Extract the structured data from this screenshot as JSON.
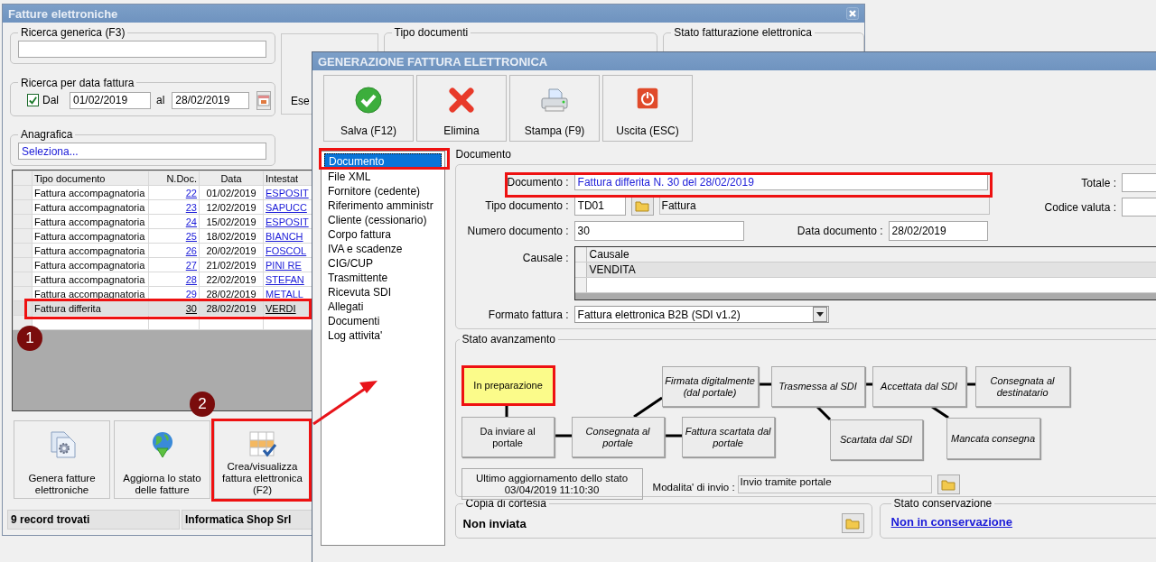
{
  "main_window": {
    "title": "Fatture elettroniche",
    "generic_search": {
      "label": "Ricerca generica (F3)"
    },
    "date_search": {
      "label": "Ricerca per data fattura",
      "from_checked": true,
      "from_label": "Dal",
      "from": "01/02/2019",
      "to_label": "al",
      "to": "28/02/2019"
    },
    "registry": {
      "label": "Anagrafica",
      "value": "Seleziona..."
    },
    "search_button": {
      "label": "Ese"
    },
    "document_types": {
      "label": "Tipo documenti"
    },
    "invoicing_status": {
      "label": "Stato fatturazione elettronica"
    },
    "table": {
      "columns": [
        "Tipo documento",
        "N.Doc.",
        "Data",
        "Intestat"
      ],
      "rows": [
        {
          "type": "Fattura accompagnatoria",
          "number": "22",
          "date": "01/02/2019",
          "holder": "ESPOSIT",
          "selected": false
        },
        {
          "type": "Fattura accompagnatoria",
          "number": "23",
          "date": "12/02/2019",
          "holder": "SAPUCC",
          "selected": false
        },
        {
          "type": "Fattura accompagnatoria",
          "number": "24",
          "date": "15/02/2019",
          "holder": "ESPOSIT",
          "selected": false
        },
        {
          "type": "Fattura accompagnatoria",
          "number": "25",
          "date": "18/02/2019",
          "holder": "BIANCH",
          "selected": false
        },
        {
          "type": "Fattura accompagnatoria",
          "number": "26",
          "date": "20/02/2019",
          "holder": "FOSCOL",
          "selected": false
        },
        {
          "type": "Fattura accompagnatoria",
          "number": "27",
          "date": "21/02/2019",
          "holder": "PINI RE",
          "selected": false
        },
        {
          "type": "Fattura accompagnatoria",
          "number": "28",
          "date": "22/02/2019",
          "holder": "STEFAN",
          "selected": false
        },
        {
          "type": "Fattura accompagnatoria",
          "number": "29",
          "date": "28/02/2019",
          "holder": "METALL",
          "selected": false
        },
        {
          "type": "Fattura differita",
          "number": "30",
          "date": "28/02/2019",
          "holder": "VERDI",
          "selected": true
        }
      ]
    },
    "actions": [
      "Genera fatture elettroniche",
      "Aggiorna lo stato delle fatture",
      "Crea/visualizza fattura elettronica (F2)"
    ],
    "status_bar": [
      "9 record trovati",
      "Informatica Shop Srl"
    ]
  },
  "markers": [
    "1",
    "2"
  ],
  "dialog": {
    "title": "GENERAZIONE FATTURA ELETTRONICA",
    "toolbar": [
      "Salva (F12)",
      "Elimina",
      "Stampa (F9)",
      "Uscita (ESC)"
    ],
    "sections": [
      {
        "label": "Documento",
        "selected": true
      },
      {
        "label": "File XML",
        "selected": false
      },
      {
        "label": "Fornitore (cedente)",
        "selected": false
      },
      {
        "label": "Riferimento amministr",
        "selected": false
      },
      {
        "label": "Cliente (cessionario)",
        "selected": false
      },
      {
        "label": "Corpo fattura",
        "selected": false
      },
      {
        "label": "IVA e scadenze",
        "selected": false
      },
      {
        "label": "CIG/CUP",
        "selected": false
      },
      {
        "label": "Trasmittente",
        "selected": false
      },
      {
        "label": "Ricevuta SDI",
        "selected": false
      },
      {
        "label": "Allegati",
        "selected": false
      },
      {
        "label": "Documenti",
        "selected": false
      },
      {
        "label": "Log attivita'",
        "selected": false
      }
    ],
    "section_title": "Documento",
    "document": {
      "label": "Documento :",
      "value": "Fattura differita N. 30 del 28/02/2019"
    },
    "doc_type": {
      "label": "Tipo documento :",
      "code": "TD01",
      "description": "Fattura"
    },
    "doc_number": {
      "label": "Numero documento :",
      "value": "30"
    },
    "doc_date": {
      "label": "Data documento :",
      "value": "28/02/2019"
    },
    "total": {
      "label": "Totale :"
    },
    "currency": {
      "label": "Codice valuta :"
    },
    "reason": {
      "label": "Causale :",
      "column": "Causale",
      "rows": [
        {
          "value": "VENDITA",
          "selected": true
        }
      ]
    },
    "format": {
      "label": "Formato fattura :",
      "value": "Fattura elettronica B2B (SDI v1.2)"
    },
    "progress": {
      "label": "Stato avanzamento",
      "steps": [
        {
          "label": "In preparazione",
          "selected": true,
          "reached": true
        },
        {
          "label": "Firmata digitalmente (dal portale)",
          "selected": false,
          "reached": false
        },
        {
          "label": "Trasmessa al SDI",
          "selected": false,
          "reached": false
        },
        {
          "label": "Accettata dal SDI",
          "selected": false,
          "reached": false
        },
        {
          "label": "Consegnata al destinatario",
          "selected": false,
          "reached": false
        },
        {
          "label": "Da inviare al portale",
          "selected": false,
          "reached": true
        },
        {
          "label": "Consegnata al portale",
          "selected": false,
          "reached": false
        },
        {
          "label": "Fattura scartata dal portale",
          "selected": false,
          "reached": false
        },
        {
          "label": "Scartata dal SDI",
          "selected": false,
          "reached": false
        },
        {
          "label": "Mancata consegna",
          "selected": false,
          "reached": false
        }
      ],
      "last_update": {
        "label": "Ultimo aggiornamento dello stato",
        "value": "03/04/2019 11:10:30"
      },
      "send_mode": {
        "label": "Modalita' di invio :",
        "value": "Invio tramite portale"
      }
    },
    "courtesy_copy": {
      "label": "Copia di cortesia",
      "value": "Non inviata"
    },
    "conservation": {
      "label": "Stato conservazione",
      "value": "Non in conservazione"
    }
  }
}
